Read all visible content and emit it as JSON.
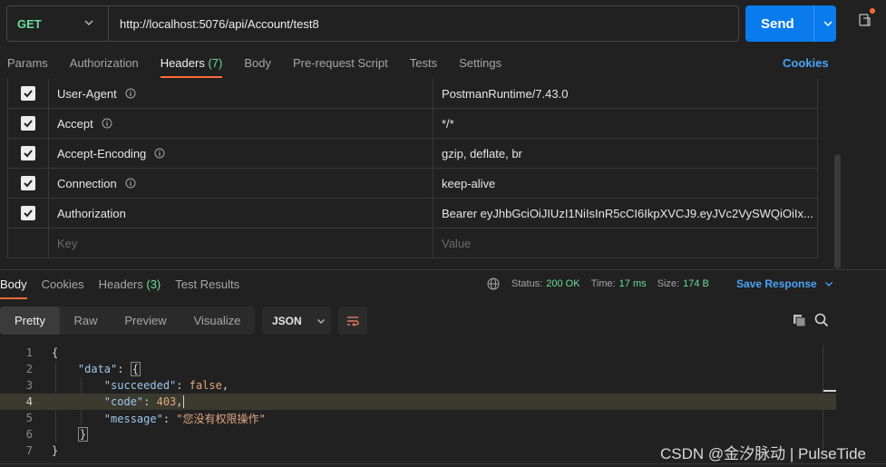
{
  "request": {
    "method": "GET",
    "url": "http://localhost:5076/api/Account/test8",
    "send_label": "Send"
  },
  "request_tabs": [
    {
      "label": "Params"
    },
    {
      "label": "Authorization"
    },
    {
      "label": "Headers",
      "count": "(7)"
    },
    {
      "label": "Body"
    },
    {
      "label": "Pre-request Script"
    },
    {
      "label": "Tests"
    },
    {
      "label": "Settings"
    }
  ],
  "cookies_label": "Cookies",
  "headers": [
    {
      "key": "User-Agent",
      "value": "PostmanRuntime/7.43.0"
    },
    {
      "key": "Accept",
      "value": "*/*"
    },
    {
      "key": "Accept-Encoding",
      "value": "gzip, deflate, br"
    },
    {
      "key": "Connection",
      "value": "keep-alive"
    },
    {
      "key": "Authorization",
      "value": "Bearer eyJhbGciOiJIUzI1NiIsInR5cCI6IkpXVCJ9.eyJVc2VySWQiOiIx..."
    }
  ],
  "headers_placeholder": {
    "key": "Key",
    "value": "Value"
  },
  "response_tabs": [
    {
      "label": "Body"
    },
    {
      "label": "Cookies"
    },
    {
      "label": "Headers",
      "count": "(3)"
    },
    {
      "label": "Test Results"
    }
  ],
  "status": {
    "status_label": "Status:",
    "status_value": "200 OK",
    "time_label": "Time:",
    "time_value": "17 ms",
    "size_label": "Size:",
    "size_value": "174 B",
    "save_label": "Save Response"
  },
  "formats": [
    "Pretty",
    "Raw",
    "Preview",
    "Visualize"
  ],
  "format_select": "JSON",
  "code_lines": [
    {
      "n": "1"
    },
    {
      "n": "2",
      "key": "\"data\""
    },
    {
      "n": "3",
      "key": "\"succeeded\"",
      "value": "false"
    },
    {
      "n": "4",
      "key": "\"code\"",
      "value": "403"
    },
    {
      "n": "5",
      "key": "\"message\"",
      "value": "\"您没有权限操作\""
    },
    {
      "n": "6"
    },
    {
      "n": "7"
    }
  ],
  "watermark": "CSDN @金汐脉动 | PulseTide"
}
